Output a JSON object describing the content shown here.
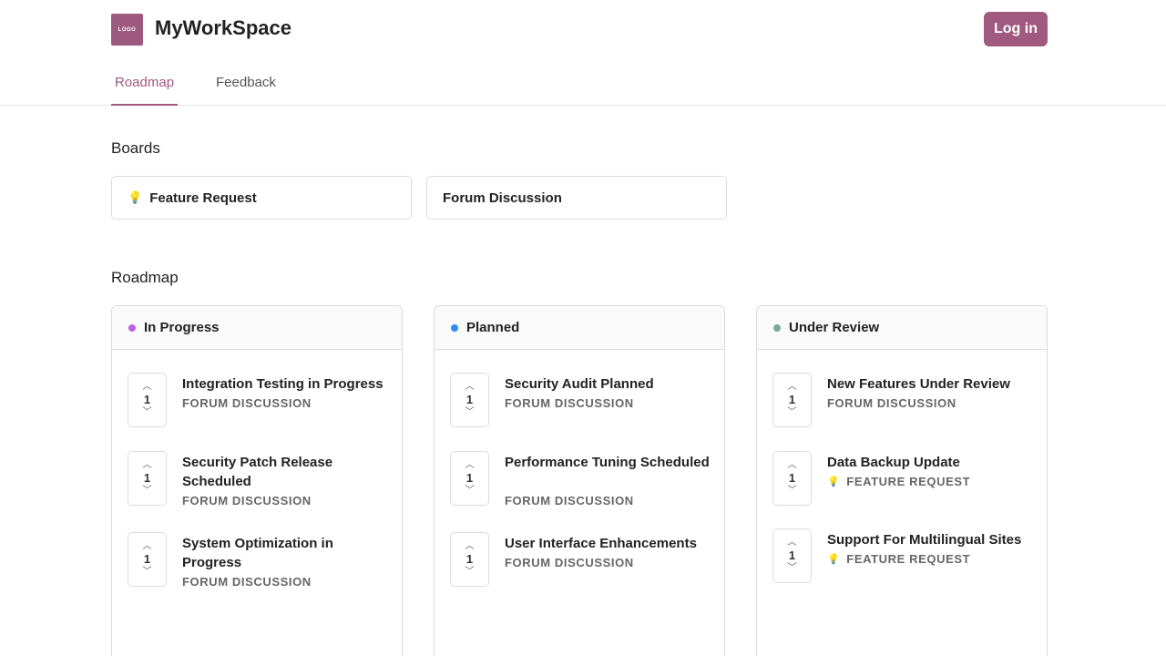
{
  "header": {
    "logo_text": "LOGO",
    "brand": "MyWorkSpace",
    "login_label": "Log in"
  },
  "tabs": [
    {
      "label": "Roadmap",
      "active": true
    },
    {
      "label": "Feedback",
      "active": false
    }
  ],
  "boards": {
    "title": "Boards",
    "items": [
      {
        "label": "Feature Request",
        "icon": "lightbulb-icon"
      },
      {
        "label": "Forum Discussion",
        "icon": ""
      }
    ]
  },
  "roadmap": {
    "title": "Roadmap",
    "columns": [
      {
        "title": "In Progress",
        "dot_color": "#c060e0",
        "items": [
          {
            "votes": "1",
            "title": "Integration Testing in Progress",
            "board": "Forum Discussion"
          },
          {
            "votes": "1",
            "title": "Security Patch Release Scheduled",
            "board": "Forum Discussion"
          },
          {
            "votes": "1",
            "title": "System Optimization in Progress",
            "board": "Forum Discussion"
          }
        ]
      },
      {
        "title": "Planned",
        "dot_color": "#2b8ef0",
        "items": [
          {
            "votes": "1",
            "title": "Security Audit Planned",
            "board": "Forum Discussion"
          },
          {
            "votes": "1",
            "title": "Performance Tuning Scheduled",
            "board": "Forum Discussion"
          },
          {
            "votes": "1",
            "title": "User Interface Enhancements",
            "board": "Forum Discussion"
          }
        ]
      },
      {
        "title": "Under Review",
        "dot_color": "#7aa8a0",
        "items": [
          {
            "votes": "1",
            "title": "New Features Under Review",
            "board": "Forum Discussion"
          },
          {
            "votes": "1",
            "title": "Data Backup Update",
            "board": "Feature Request",
            "board_icon": "lightbulb-icon"
          },
          {
            "votes": "1",
            "title": "Support For Multilingual Sites",
            "board": "Feature Request",
            "board_icon": "lightbulb-icon"
          }
        ]
      }
    ]
  },
  "colors": {
    "accent": "#a05a7f",
    "border": "#dcdcdc"
  }
}
